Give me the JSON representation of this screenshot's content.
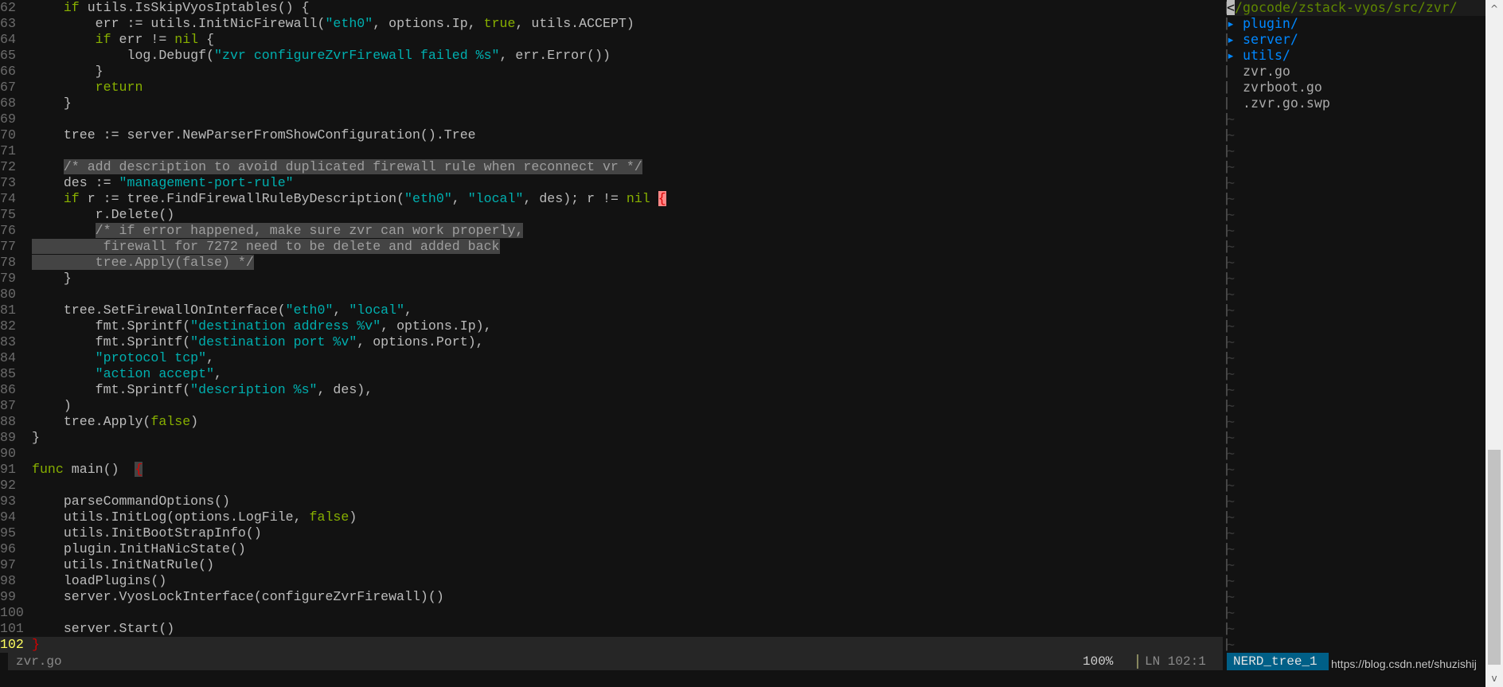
{
  "editor": {
    "lines": [
      {
        "n": "62",
        "tokens": [
          [
            "t",
            "    "
          ],
          [
            "k",
            "if"
          ],
          [
            "t",
            " utils.IsSkipVyosIptables() {"
          ]
        ]
      },
      {
        "n": "63",
        "tokens": [
          [
            "t",
            "        err := utils.InitNicFirewall("
          ],
          [
            "s",
            "\"eth0\""
          ],
          [
            "t",
            ", options.Ip, "
          ],
          [
            "k",
            "true"
          ],
          [
            "t",
            ", utils.ACCEPT)"
          ]
        ]
      },
      {
        "n": "64",
        "tokens": [
          [
            "t",
            "        "
          ],
          [
            "k",
            "if"
          ],
          [
            "t",
            " err != "
          ],
          [
            "k",
            "nil"
          ],
          [
            "t",
            " {"
          ]
        ]
      },
      {
        "n": "65",
        "tokens": [
          [
            "t",
            "            log.Debugf("
          ],
          [
            "s",
            "\"zvr configureZvrFirewall failed %s\""
          ],
          [
            "t",
            ", err.Error())"
          ]
        ]
      },
      {
        "n": "66",
        "tokens": [
          [
            "t",
            "        }"
          ]
        ]
      },
      {
        "n": "67",
        "tokens": [
          [
            "t",
            "        "
          ],
          [
            "k",
            "return"
          ]
        ]
      },
      {
        "n": "68",
        "tokens": [
          [
            "t",
            "    }"
          ]
        ]
      },
      {
        "n": "69",
        "tokens": []
      },
      {
        "n": "70",
        "tokens": [
          [
            "t",
            "    tree := server.NewParserFromShowConfiguration().Tree"
          ]
        ]
      },
      {
        "n": "71",
        "tokens": []
      },
      {
        "n": "72",
        "tokens": [
          [
            "t",
            "    "
          ],
          [
            "c",
            "/* add description to avoid duplicated firewall rule when reconnect vr */"
          ]
        ]
      },
      {
        "n": "73",
        "tokens": [
          [
            "t",
            "    des := "
          ],
          [
            "s",
            "\"management-port-rule\""
          ]
        ]
      },
      {
        "n": "74",
        "tokens": [
          [
            "t",
            "    "
          ],
          [
            "k",
            "if"
          ],
          [
            "t",
            " r := tree.FindFirewallRuleByDescription("
          ],
          [
            "s",
            "\"eth0\""
          ],
          [
            "t",
            ", "
          ],
          [
            "s",
            "\"local\""
          ],
          [
            "t",
            ", des); r != "
          ],
          [
            "k",
            "nil"
          ],
          [
            "t",
            " "
          ],
          [
            "bm",
            "{"
          ]
        ]
      },
      {
        "n": "75",
        "tokens": [
          [
            "t",
            "        r.Delete()"
          ]
        ]
      },
      {
        "n": "76",
        "tokens": [
          [
            "t",
            "        "
          ],
          [
            "c",
            "/* if error happened, make sure zvr can work properly,"
          ]
        ]
      },
      {
        "n": "77",
        "tokens": [
          [
            "c",
            "         firewall for 7272 need to be delete and added back"
          ]
        ]
      },
      {
        "n": "78",
        "tokens": [
          [
            "c",
            "        tree.Apply(false) */"
          ]
        ]
      },
      {
        "n": "79",
        "tokens": [
          [
            "t",
            "    }"
          ]
        ]
      },
      {
        "n": "80",
        "tokens": []
      },
      {
        "n": "81",
        "tokens": [
          [
            "t",
            "    tree.SetFirewallOnInterface("
          ],
          [
            "s",
            "\"eth0\""
          ],
          [
            "t",
            ", "
          ],
          [
            "s",
            "\"local\""
          ],
          [
            "t",
            ","
          ]
        ]
      },
      {
        "n": "82",
        "tokens": [
          [
            "t",
            "        fmt.Sprintf("
          ],
          [
            "s",
            "\"destination address %v\""
          ],
          [
            "t",
            ", options.Ip),"
          ]
        ]
      },
      {
        "n": "83",
        "tokens": [
          [
            "t",
            "        fmt.Sprintf("
          ],
          [
            "s",
            "\"destination port %v\""
          ],
          [
            "t",
            ", options.Port),"
          ]
        ]
      },
      {
        "n": "84",
        "tokens": [
          [
            "t",
            "        "
          ],
          [
            "s",
            "\"protocol tcp\""
          ],
          [
            "t",
            ","
          ]
        ]
      },
      {
        "n": "85",
        "tokens": [
          [
            "t",
            "        "
          ],
          [
            "s",
            "\"action accept\""
          ],
          [
            "t",
            ","
          ]
        ]
      },
      {
        "n": "86",
        "tokens": [
          [
            "t",
            "        fmt.Sprintf("
          ],
          [
            "s",
            "\"description %s\""
          ],
          [
            "t",
            ", des),"
          ]
        ]
      },
      {
        "n": "87",
        "tokens": [
          [
            "t",
            "    )"
          ]
        ]
      },
      {
        "n": "88",
        "tokens": [
          [
            "t",
            "    tree.Apply("
          ],
          [
            "k",
            "false"
          ],
          [
            "t",
            ")"
          ]
        ]
      },
      {
        "n": "89",
        "tokens": [
          [
            "t",
            "}"
          ]
        ]
      },
      {
        "n": "90",
        "tokens": []
      },
      {
        "n": "91",
        "tokens": [
          [
            "k",
            "func"
          ],
          [
            "t",
            " main()  "
          ],
          [
            "bg",
            "{"
          ]
        ]
      },
      {
        "n": "92",
        "tokens": []
      },
      {
        "n": "93",
        "tokens": [
          [
            "t",
            "    parseCommandOptions()"
          ]
        ]
      },
      {
        "n": "94",
        "tokens": [
          [
            "t",
            "    utils.InitLog(options.LogFile, "
          ],
          [
            "k",
            "false"
          ],
          [
            "t",
            ")"
          ]
        ]
      },
      {
        "n": "95",
        "tokens": [
          [
            "t",
            "    utils.InitBootStrapInfo()"
          ]
        ]
      },
      {
        "n": "96",
        "tokens": [
          [
            "t",
            "    plugin.InitHaNicState()"
          ]
        ]
      },
      {
        "n": "97",
        "tokens": [
          [
            "t",
            "    utils.InitNatRule()"
          ]
        ]
      },
      {
        "n": "98",
        "tokens": [
          [
            "t",
            "    loadPlugins()"
          ]
        ]
      },
      {
        "n": "99",
        "tokens": [
          [
            "t",
            "    server.VyosLockInterface(configureZvrFirewall)()"
          ]
        ]
      },
      {
        "n": "100",
        "tokens": []
      },
      {
        "n": "101",
        "tokens": [
          [
            "t",
            "    server.Start()"
          ]
        ]
      },
      {
        "n": "102",
        "tokens": [
          [
            "br",
            "}"
          ]
        ],
        "current": true
      }
    ]
  },
  "tree": {
    "up_marker": "<",
    "root": "/gocode/zstack-vyos/src/zvr/",
    "dir_arrow": "▸",
    "dirs": [
      "plugin/",
      "server/",
      "utils/"
    ],
    "files": [
      "zvr.go",
      "zvrboot.go",
      ".zvr.go.swp"
    ],
    "empty_marker": "~"
  },
  "status": {
    "filename": "zvr.go",
    "percent": "100%",
    "position": "LN 102:1",
    "tree_name": "NERD_tree_1"
  },
  "watermark": "https://blog.csdn.net/shuzishij",
  "colors": {
    "keyword": "#87af00",
    "string": "#00afaf",
    "directory": "#0087ff",
    "tree_status_bg": "#005f87"
  }
}
